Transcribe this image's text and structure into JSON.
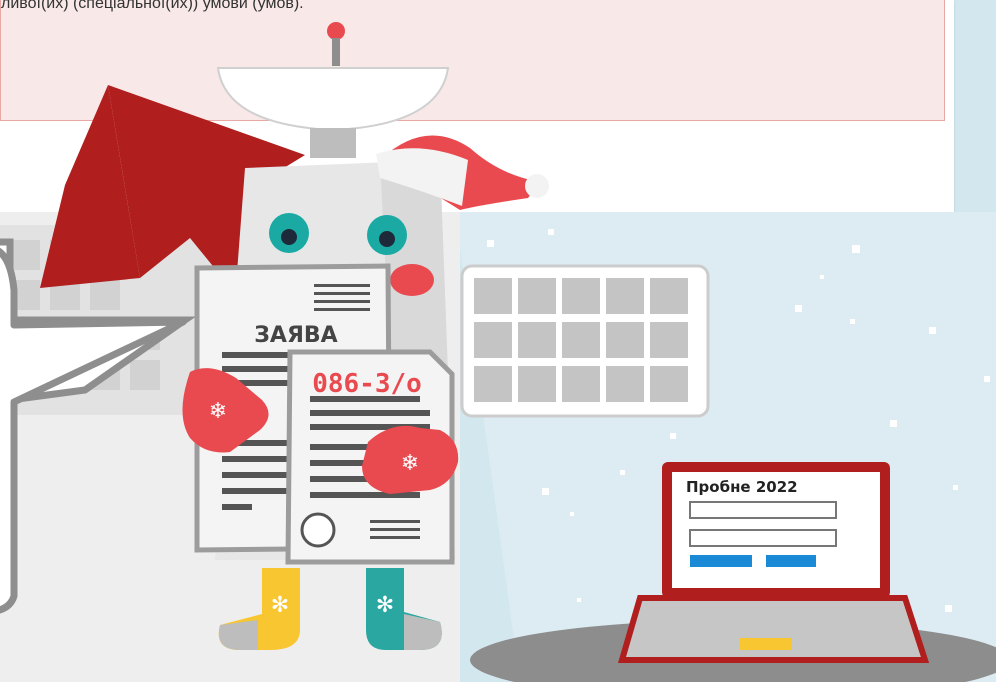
{
  "notice": {
    "text": "ливої(их) (спеціальної(их)) умови (умов)."
  },
  "illustration": {
    "application_doc_title": "ЗАЯВА",
    "medical_form_code": "086-3/о",
    "laptop_title": "Пробне 2022"
  },
  "colors": {
    "arrow": "#b01e1e",
    "background": "#d3e7ef",
    "laptop_frame": "#b01e1e",
    "mitten": "#e84a4f",
    "hat": "#e84a4f",
    "eyes": "#1aa9a3",
    "sock_yellow": "#f8c630",
    "sock_teal": "#2aa7a0",
    "laptop_button": "#1a8ad6"
  }
}
